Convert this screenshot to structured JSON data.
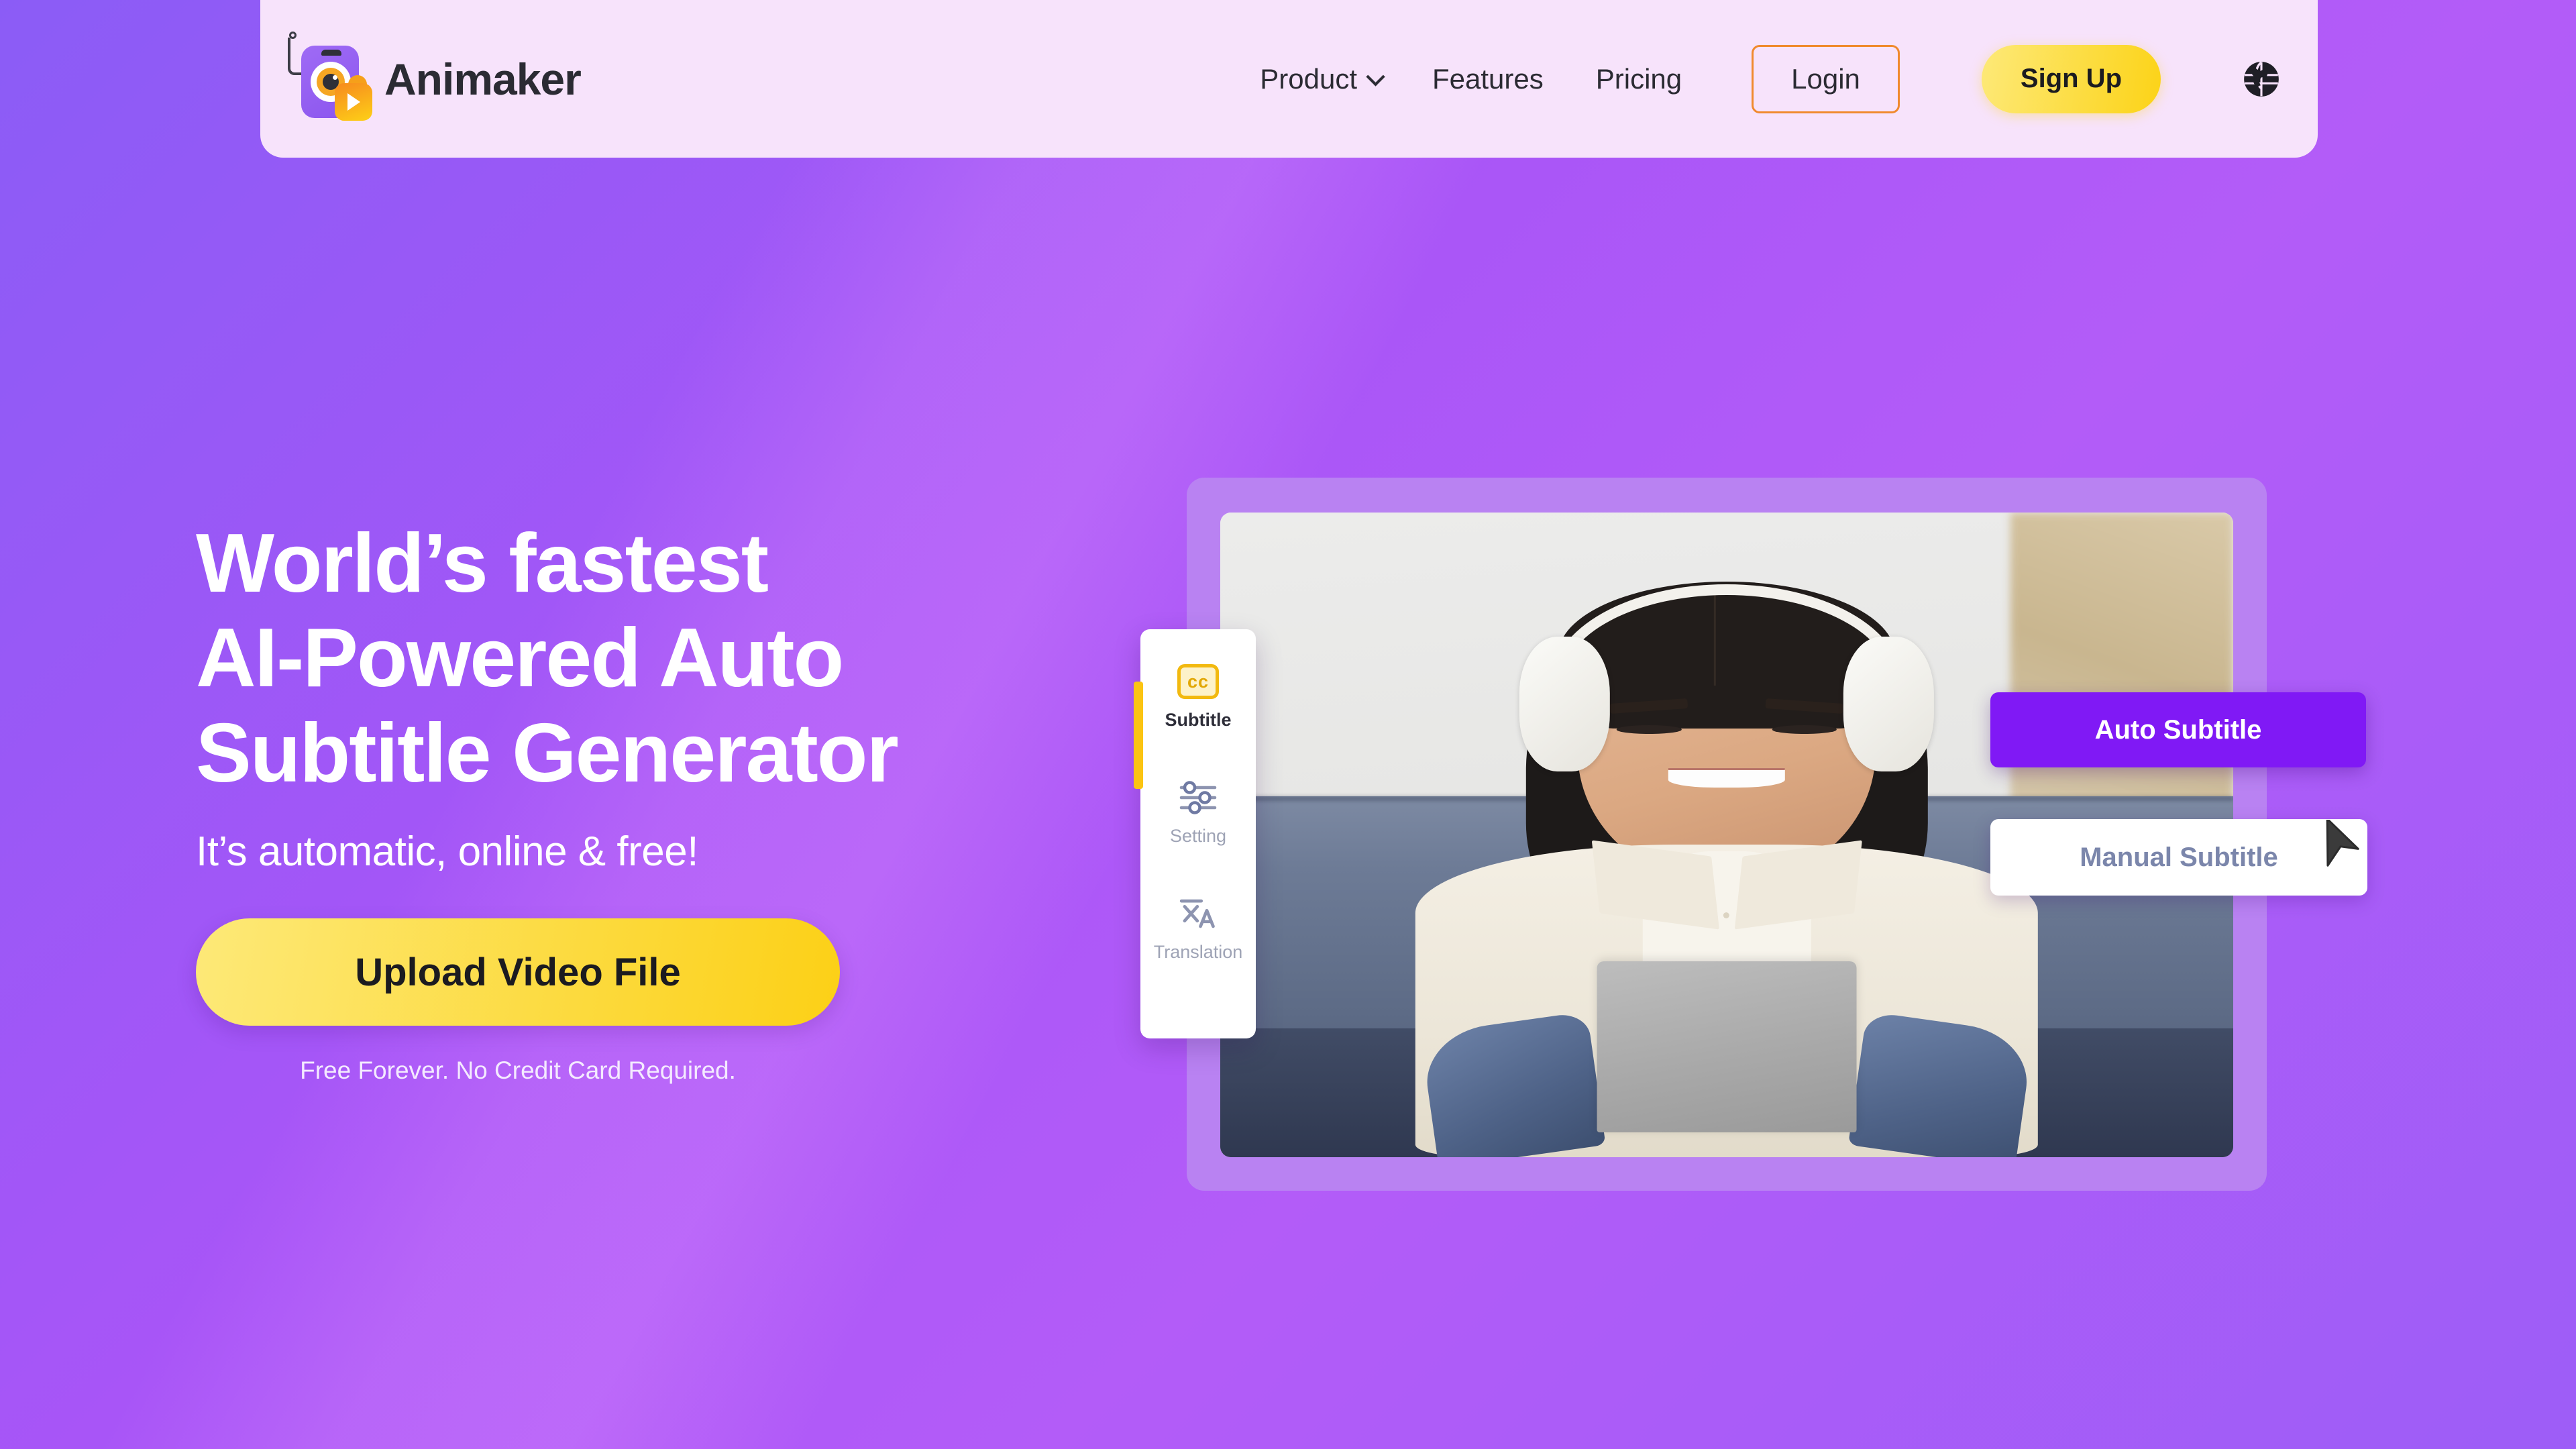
{
  "header": {
    "brand": {
      "name": "Animaker",
      "logo_icon": "animaker-robot-logo"
    },
    "nav": [
      {
        "label": "Product",
        "has_dropdown": true,
        "icon": "chevron-down-icon"
      },
      {
        "label": "Features",
        "has_dropdown": false
      },
      {
        "label": "Pricing",
        "has_dropdown": false
      }
    ],
    "login_label": "Login",
    "signup_label": "Sign Up",
    "language_icon": "globe-icon",
    "background_color": "#F7E3FB"
  },
  "hero": {
    "headline_line1": "World’s fastest",
    "headline_line2": "AI-Powered Auto",
    "headline_line3": "Subtitle Generator",
    "subheadline": "It’s automatic, online & free!",
    "cta_label": "Upload Video File",
    "cta_note": "Free Forever. No Credit Card Required."
  },
  "editor_mock": {
    "sidebar": [
      {
        "label": "Subtitle",
        "icon": "cc-icon",
        "active": true
      },
      {
        "label": "Setting",
        "icon": "sliders-icon",
        "active": false
      },
      {
        "label": "Translation",
        "icon": "translate-icon",
        "active": false
      }
    ],
    "options": [
      {
        "label": "Auto Subtitle",
        "selected": true
      },
      {
        "label": "Manual Subtitle",
        "selected": false
      }
    ],
    "cursor_icon": "mouse-pointer-icon"
  },
  "colors": {
    "background_gradient_start": "#8B5CF6",
    "background_gradient_end": "#A855F7",
    "accent_yellow": "#FCD317",
    "accent_purple": "#8019F5",
    "header_bg": "#F7E3FB",
    "login_border": "#F08A2E",
    "frame_purple": "#B982F2"
  }
}
